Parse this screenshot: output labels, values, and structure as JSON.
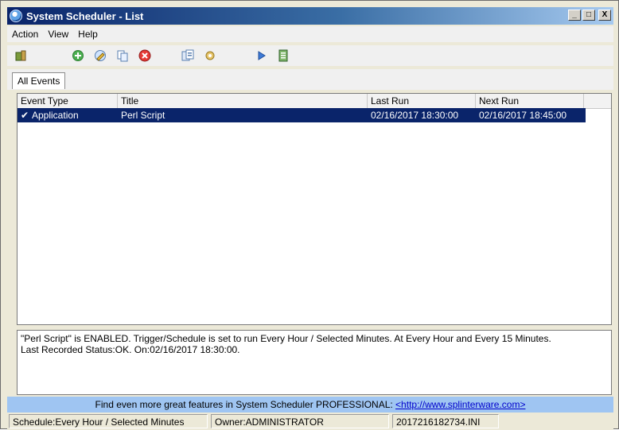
{
  "window": {
    "title": "System Scheduler - List"
  },
  "title_controls": {
    "minimize_glyph": "_",
    "maximize_glyph": "□",
    "close_glyph": "X"
  },
  "menu": [
    "Action",
    "View",
    "Help"
  ],
  "toolbar": {
    "icons": [
      "exit-icon",
      "add-icon",
      "edit-icon",
      "copy-icon",
      "delete-icon",
      "view-icon",
      "settings-icon",
      "run-icon",
      "log-icon"
    ]
  },
  "tabs": [
    "All Events"
  ],
  "list": {
    "columns": [
      "Event Type",
      "Title",
      "Last Run",
      "Next Run",
      ""
    ],
    "rows": [
      {
        "check": "✔",
        "event_type": "Application",
        "title": "Perl Script",
        "last_run": "02/16/2017 18:30:00",
        "next_run": "02/16/2017 18:45:00"
      }
    ]
  },
  "description": {
    "line1": "\"Perl Script\" is ENABLED. Trigger/Schedule is set to run Every Hour / Selected Minutes. At Every Hour and Every 15 Minutes.",
    "line2": "Last Recorded Status:OK. On:02/16/2017 18:30:00."
  },
  "promo": {
    "text": "Find even more great features in System Scheduler PROFESSIONAL: ",
    "link": "<http://www.splinterware.com>"
  },
  "status": {
    "schedule": "Schedule:Every Hour / Selected Minutes",
    "owner": "Owner:ADMINISTRATOR",
    "file": "2017216182734.INI"
  },
  "colors": {
    "selection": "#0a246a",
    "promo_bg": "#9fc5f2",
    "link": "#0000cc"
  }
}
